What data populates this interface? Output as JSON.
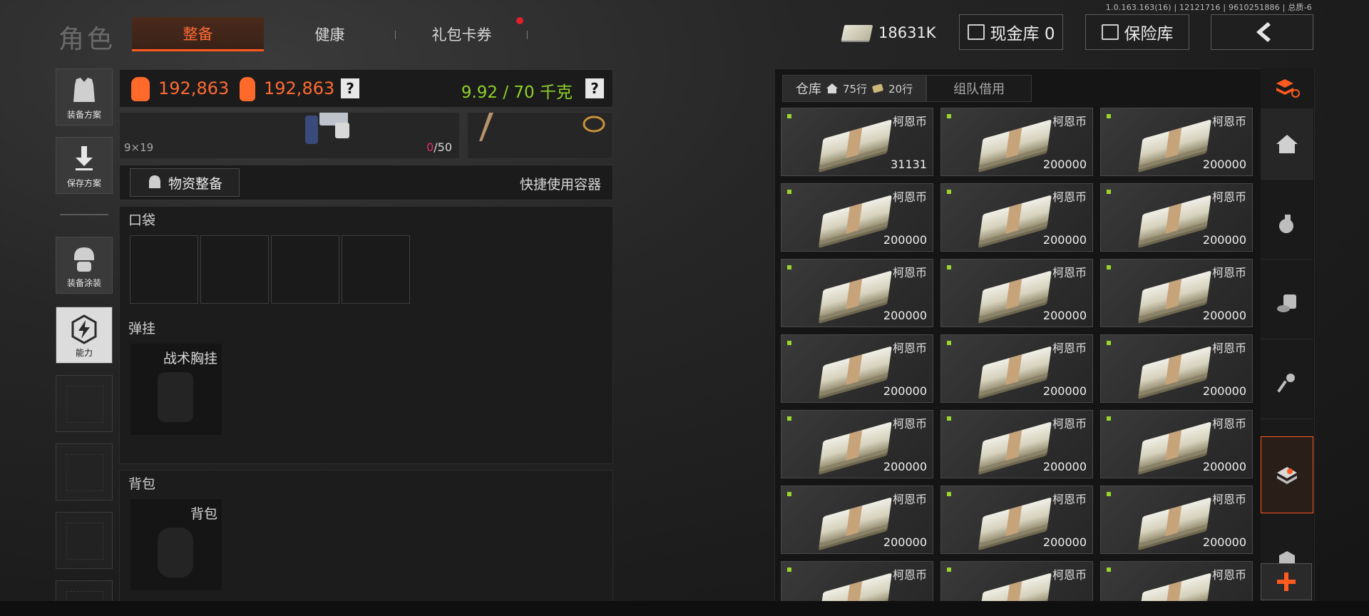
{
  "version": "1.0.163.163(16) | 12121716 | 9610251886 | 总质-6",
  "header": {
    "title": "角色",
    "tabs": [
      {
        "label": "整备",
        "active": true
      },
      {
        "label": "健康",
        "active": false
      },
      {
        "label": "礼包卡券",
        "active": false,
        "notification": true
      }
    ],
    "money": "18631K",
    "cash_button": "现金库 0",
    "safe_button": "保险库"
  },
  "left_nav": [
    {
      "label": "装备方案",
      "icon": "vest-icon"
    },
    {
      "label": "保存方案",
      "icon": "download-icon"
    },
    {
      "label": "装备涂装",
      "icon": "helmet-mask-icon"
    },
    {
      "label": "能力",
      "icon": "lightning-hex-icon",
      "active": true
    }
  ],
  "stats": {
    "value_a": "192,863",
    "value_b": "192,863",
    "weight": "9.92 / 70 千克",
    "help": "?"
  },
  "equipment": {
    "grid_size": "9×19",
    "cap_current": "0",
    "cap_total": "/50"
  },
  "supply": {
    "button": "物资整备",
    "quick": "快捷使用容器"
  },
  "sections": {
    "pocket": "口袋",
    "rig": "弹挂",
    "rig_slot": "战术胸挂",
    "backpack": "背包",
    "backpack_slot": "背包"
  },
  "warehouse": {
    "tab_label": "仓库",
    "rows_a": "75行",
    "rows_b": "20行",
    "team_tab": "组队借用",
    "items": [
      {
        "name": "柯恩币",
        "count": "31131"
      },
      {
        "name": "柯恩币",
        "count": "200000"
      },
      {
        "name": "柯恩币",
        "count": "200000"
      },
      {
        "name": "柯恩币",
        "count": "200000"
      },
      {
        "name": "柯恩币",
        "count": "200000"
      },
      {
        "name": "柯恩币",
        "count": "200000"
      },
      {
        "name": "柯恩币",
        "count": "200000"
      },
      {
        "name": "柯恩币",
        "count": "200000"
      },
      {
        "name": "柯恩币",
        "count": "200000"
      },
      {
        "name": "柯恩币",
        "count": "200000"
      },
      {
        "name": "柯恩币",
        "count": "200000"
      },
      {
        "name": "柯恩币",
        "count": "200000"
      },
      {
        "name": "柯恩币",
        "count": "200000"
      },
      {
        "name": "柯恩币",
        "count": "200000"
      },
      {
        "name": "柯恩币",
        "count": "200000"
      },
      {
        "name": "柯恩币",
        "count": "200000"
      },
      {
        "name": "柯恩币",
        "count": "200000"
      },
      {
        "name": "柯恩币",
        "count": "200000"
      },
      {
        "name": "柯恩币",
        "count": ""
      },
      {
        "name": "柯恩币",
        "count": ""
      },
      {
        "name": "柯恩币",
        "count": ""
      }
    ]
  },
  "colors": {
    "accent": "#ff5a1f",
    "weight_green": "#8ed12a",
    "dot_green": "#9ad72a"
  }
}
